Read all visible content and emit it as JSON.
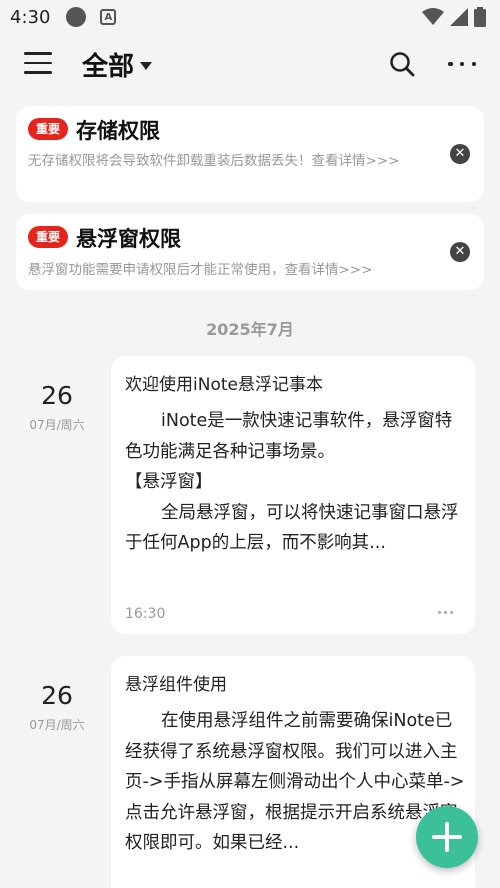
{
  "status_bar": {
    "time": "4:30",
    "badge_glyph": "A"
  },
  "header": {
    "title": "全部"
  },
  "notices": [
    {
      "badge": "重要",
      "title": "存储权限",
      "desc": "无存储权限将会导致软件卸载重装后数据丢失！查看详情>>>"
    },
    {
      "badge": "重要",
      "title": "悬浮窗权限",
      "desc": "悬浮窗功能需要申请权限后才能正常使用，查看详情>>>"
    }
  ],
  "month_header": "2025年7月",
  "notes": [
    {
      "day": "26",
      "sub": "07月/周六",
      "title": "欢迎使用iNote悬浮记事本",
      "para1": "iNote是一款快速记事软件，悬浮窗特色功能满足各种记事场景。",
      "para2": "【悬浮窗】",
      "para3": "全局悬浮窗，可以将快速记事窗口悬浮于任何App的上层，而不影响其...",
      "time": "16:30"
    },
    {
      "day": "26",
      "sub": "07月/周六",
      "title": "悬浮组件使用",
      "para1": "在使用悬浮组件之前需要确保iNote已经获得了系统悬浮窗权限。我们可以进入主页->手指从屏幕左侧滑动出个人中心菜单->点击允许悬浮窗，根据提示开启系统悬浮窗权限即可。如果已经..."
    }
  ],
  "colors": {
    "accent": "#3cc09a",
    "badge": "#e5251d",
    "background": "#f4f4f4"
  }
}
